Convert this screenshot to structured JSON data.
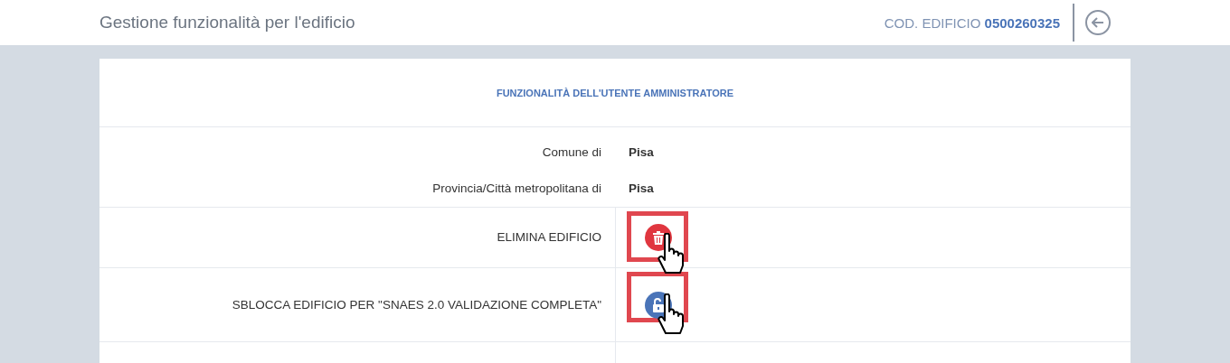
{
  "header": {
    "title": "Gestione funzionalità per l'edificio",
    "code_label": "COD. EDIFICIO",
    "code_value": "0500260325"
  },
  "card": {
    "title": "FUNZIONALITÀ DELL'UTENTE AMMINISTRATORE",
    "info": [
      {
        "label": "Comune di",
        "value": "Pisa"
      },
      {
        "label": "Provincia/Città metropolitana di",
        "value": "Pisa"
      }
    ],
    "actions": [
      {
        "label": "ELIMINA EDIFICIO",
        "kind": "delete",
        "highlighted": true
      },
      {
        "label": "SBLOCCA EDIFICIO PER \"SNAES 2.0 VALIDAZIONE COMPLETA\"",
        "kind": "unlock",
        "highlighted": true
      }
    ]
  }
}
